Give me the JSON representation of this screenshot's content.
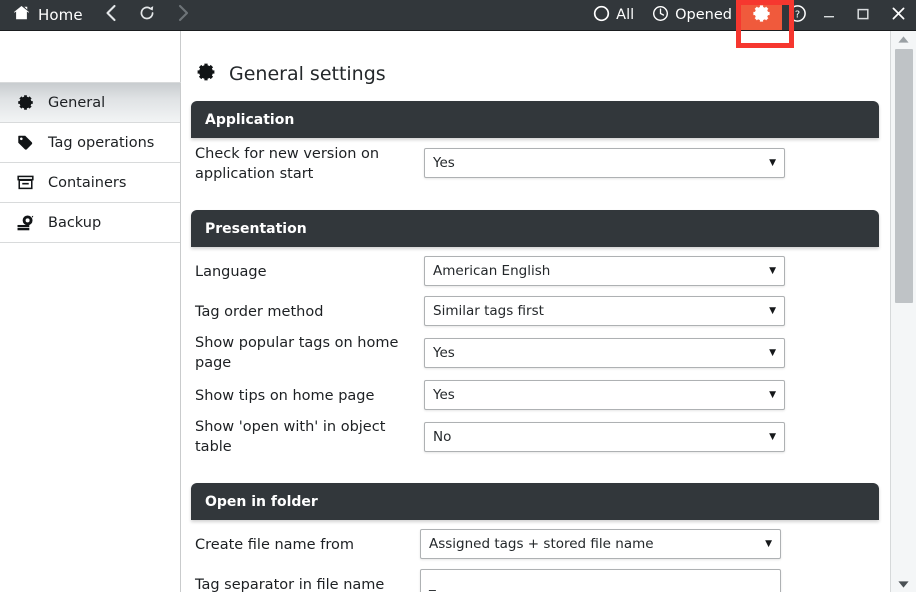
{
  "titlebar": {
    "home_label": "Home",
    "back_icon": "chevron-left-icon",
    "refresh_icon": "refresh-icon",
    "forward_icon": "chevron-right-icon",
    "all_label": "All",
    "opened_label": "Opened",
    "gear_icon": "gear-icon",
    "help_icon": "help-icon",
    "minimize_icon": "minimize-icon",
    "maximize_icon": "maximize-icon",
    "close_icon": "close-icon",
    "gear_highlight_color": "#f05a3c",
    "annotation_color": "#f6372f",
    "bar_color": "#32373b"
  },
  "sidebar": {
    "items": [
      {
        "label": "General",
        "icon": "gear-icon",
        "selected": true
      },
      {
        "label": "Tag operations",
        "icon": "tag-icon",
        "selected": false
      },
      {
        "label": "Containers",
        "icon": "archive-box-icon",
        "selected": false
      },
      {
        "label": "Backup",
        "icon": "backup-disk-icon",
        "selected": false
      }
    ]
  },
  "page": {
    "title": "General settings",
    "title_icon": "gear-icon"
  },
  "sections": [
    {
      "header": "Application",
      "rows": [
        {
          "label": "Check for new version on application start",
          "control": "select",
          "value": "Yes"
        }
      ]
    },
    {
      "header": "Presentation",
      "rows": [
        {
          "label": "Language",
          "control": "select",
          "value": "American English"
        },
        {
          "label": "Tag order method",
          "control": "select",
          "value": "Similar tags first"
        },
        {
          "label": "Show popular tags on home page",
          "control": "select",
          "value": "Yes"
        },
        {
          "label": "Show tips on home page",
          "control": "select",
          "value": "Yes"
        },
        {
          "label": "Show 'open with' in object table",
          "control": "select",
          "value": "No"
        }
      ]
    },
    {
      "header": "Open in folder",
      "rows": [
        {
          "label": "Create file name from",
          "control": "select",
          "value": "Assigned tags + stored file name"
        },
        {
          "label": "Tag separator in file name",
          "control": "text",
          "value": "_"
        }
      ]
    }
  ],
  "scrollbar": {
    "up_icon": "scroll-up-arrow-icon",
    "down_icon": "scroll-down-arrow-icon",
    "thumb": "scrollbar-thumb"
  }
}
